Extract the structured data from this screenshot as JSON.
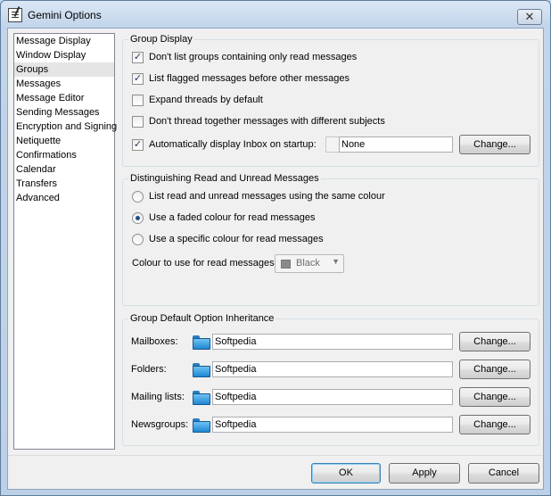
{
  "window": {
    "title": "Gemini Options",
    "close_glyph": "✕"
  },
  "nav": {
    "items": [
      "Message Display",
      "Window Display",
      "Groups",
      "Messages",
      "Message Editor",
      "Sending Messages",
      "Encryption and Signing",
      "Netiquette",
      "Confirmations",
      "Calendar",
      "Transfers",
      "Advanced"
    ],
    "selected": "Groups"
  },
  "group_display": {
    "legend": "Group Display",
    "options": [
      {
        "label": "Don't list groups containing only read messages",
        "checked": true
      },
      {
        "label": "List flagged messages before other messages",
        "checked": true
      },
      {
        "label": "Expand threads by default",
        "checked": false
      },
      {
        "label": "Don't thread together messages with different subjects",
        "checked": false
      },
      {
        "label": "Automatically display Inbox on startup:",
        "checked": true
      }
    ],
    "inbox_value": "None",
    "change_label": "Change..."
  },
  "read_unread": {
    "legend": "Distinguishing Read and Unread Messages",
    "options": [
      {
        "label": "List read and unread messages using the same colour",
        "selected": false
      },
      {
        "label": "Use a faded colour for read messages",
        "selected": true
      },
      {
        "label": "Use a specific colour for read messages",
        "selected": false
      }
    ],
    "colour_label": "Colour to use for read messages:",
    "colour_value": "Black"
  },
  "inheritance": {
    "legend": "Group Default Option Inheritance",
    "rows": [
      {
        "label": "Mailboxes:",
        "value": "Softpedia",
        "button": "Change..."
      },
      {
        "label": "Folders:",
        "value": "Softpedia",
        "button": "Change..."
      },
      {
        "label": "Mailing lists:",
        "value": "Softpedia",
        "button": "Change..."
      },
      {
        "label": "Newsgroups:",
        "value": "Softpedia",
        "button": "Change..."
      }
    ]
  },
  "footer": {
    "ok": "OK",
    "apply": "Apply",
    "cancel": "Cancel"
  },
  "icons": {
    "app": "app-document-icon",
    "close": "close-icon",
    "folder": "folder-icon",
    "checkmark": "✓",
    "dropdown": "▼"
  },
  "colors": {
    "accent": "#1f4b8a",
    "folder": "#1f87d2",
    "selection": "#e5e5e5"
  }
}
